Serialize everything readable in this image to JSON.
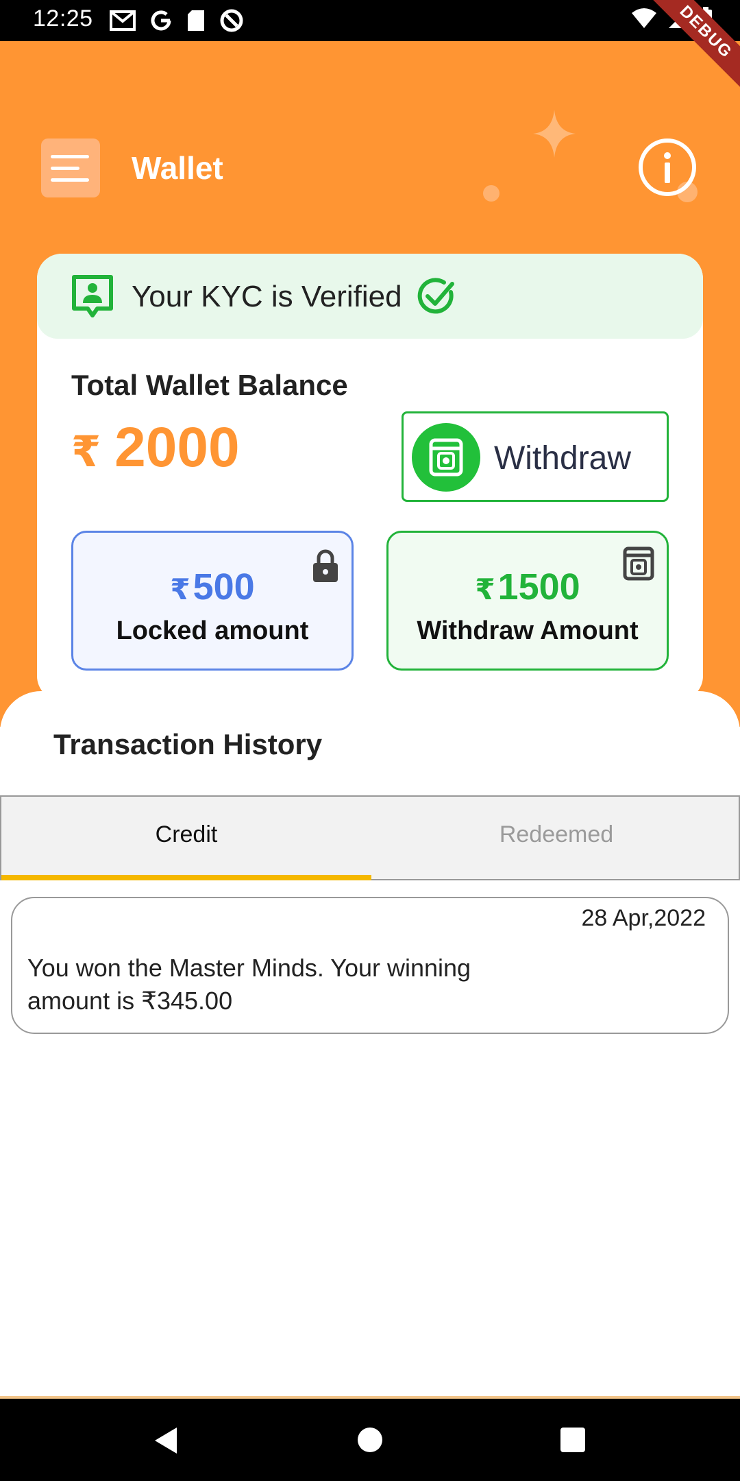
{
  "status_bar": {
    "time": "12:25",
    "left_icons": [
      "gmail-icon",
      "google-icon",
      "sd-card-icon",
      "no-disturb-icon"
    ],
    "right_icons": [
      "wifi-icon",
      "signal-icon",
      "battery-icon"
    ]
  },
  "debug_ribbon": "DEBUG",
  "header": {
    "title": "Wallet",
    "menu_icon": "hamburger-menu-icon",
    "info_icon": "info-icon"
  },
  "kyc": {
    "text": "Your KYC is Verified",
    "icon": "id-badge-icon",
    "check_icon": "check-circle-icon"
  },
  "balance": {
    "label": "Total Wallet Balance",
    "currency": "₹",
    "value": "2000"
  },
  "withdraw_button": {
    "label": "Withdraw",
    "icon": "atm-icon"
  },
  "locked": {
    "currency": "₹",
    "value": "500",
    "label": "Locked amount",
    "icon": "lock-icon"
  },
  "withdrawable": {
    "currency": "₹",
    "value": "1500",
    "label": "Withdraw Amount",
    "icon": "atm-icon"
  },
  "transactions": {
    "title": "Transaction History",
    "tabs": [
      {
        "label": "Credit",
        "active": true
      },
      {
        "label": "Redeemed",
        "active": false
      }
    ],
    "items": [
      {
        "date": "28 Apr,2022",
        "text": "You won the Master Minds. Your winning\n amount is ₹345.00"
      }
    ]
  },
  "colors": {
    "header_orange": "#FF9533",
    "verified_green": "#22B33A",
    "locked_blue": "#4A79E6",
    "tab_indicator": "#F5B800"
  }
}
